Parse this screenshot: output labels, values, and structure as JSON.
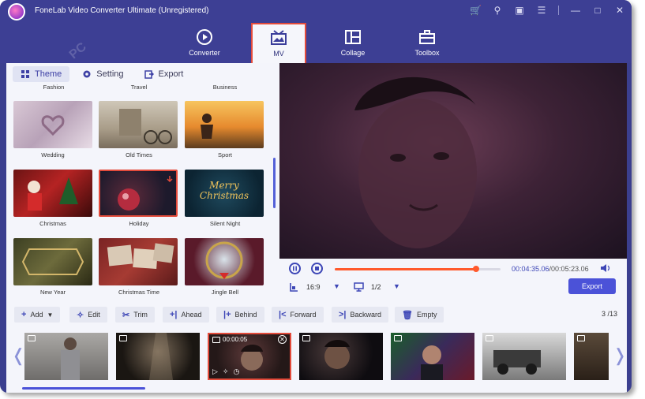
{
  "app": {
    "title": "FoneLab Video Converter Ultimate (Unregistered)",
    "watermark": "PC"
  },
  "window_controls": [
    "cart-icon",
    "key-icon",
    "feedback-icon",
    "menu-icon",
    "minimize-icon",
    "maximize-icon",
    "close-icon"
  ],
  "nav": {
    "tabs": [
      {
        "label": "Converter",
        "icon": "converter-icon"
      },
      {
        "label": "MV",
        "icon": "mv-icon",
        "active": true
      },
      {
        "label": "Collage",
        "icon": "collage-icon"
      },
      {
        "label": "Toolbox",
        "icon": "toolbox-icon"
      }
    ]
  },
  "subtabs": {
    "theme": "Theme",
    "setting": "Setting",
    "export": "Export"
  },
  "themes": {
    "top_labels": [
      "Fashion",
      "Travel",
      "Business"
    ],
    "items": [
      {
        "label": "Wedding"
      },
      {
        "label": "Old Times"
      },
      {
        "label": "Sport"
      },
      {
        "label": "Christmas"
      },
      {
        "label": "Holiday",
        "selected": true
      },
      {
        "label": "Silent Night",
        "art_text": "Merry Christmas"
      },
      {
        "label": "New Year"
      },
      {
        "label": "Christmas Time"
      },
      {
        "label": "Jingle Bell"
      }
    ]
  },
  "player": {
    "current_time": "00:04:35.06",
    "total_time": "/00:05:23.06",
    "progress": 0.85,
    "aspect_ratio": "16:9",
    "screen": "1/2",
    "export_label": "Export"
  },
  "toolbar": {
    "add": "Add",
    "edit": "Edit",
    "trim": "Trim",
    "ahead": "Ahead",
    "behind": "Behind",
    "forward": "Forward",
    "backward": "Backward",
    "empty": "Empty",
    "count_current": "3",
    "count_total": "/13"
  },
  "clips": {
    "active_duration": "00:00:05"
  },
  "colors": {
    "accent": "#4b52d8",
    "nav_bg": "#3d3f94",
    "highlight": "#e34b3b",
    "progress": "#ff5a2d"
  }
}
